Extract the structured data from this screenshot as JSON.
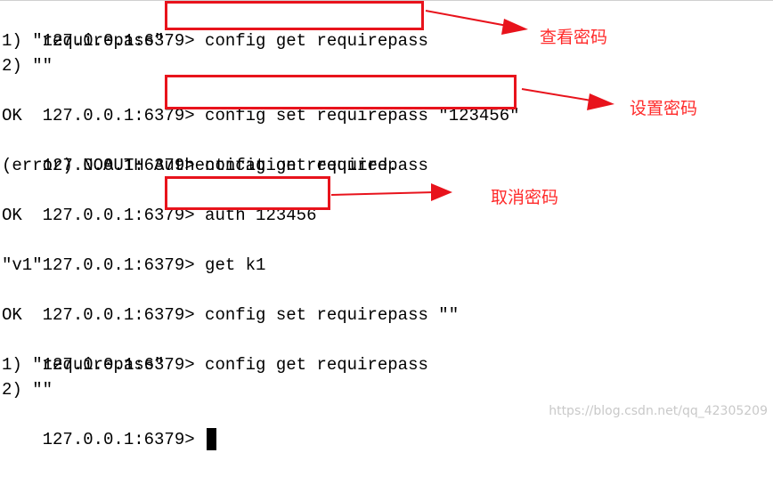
{
  "terminal": {
    "prompt": "127.0.0.1:6379> ",
    "lines": [
      {
        "prompt": "127.0.0.1:6379> ",
        "text": "config get requirepass"
      },
      {
        "text": "1) \"requirepass\""
      },
      {
        "text": "2) \"\""
      },
      {
        "prompt": "127.0.0.1:6379> ",
        "text": "config set requirepass \"123456\""
      },
      {
        "text": "OK"
      },
      {
        "prompt": "127.0.0.1:6379> ",
        "text": "config get requirepass"
      },
      {
        "text": "(error) NOAUTH Authentication required."
      },
      {
        "prompt": "127.0.0.1:6379> ",
        "text": "auth 123456"
      },
      {
        "text": "OK"
      },
      {
        "prompt": "127.0.0.1:6379> ",
        "text": "get k1"
      },
      {
        "text": "\"v1\""
      },
      {
        "prompt": "127.0.0.1:6379> ",
        "text": "config set requirepass \"\""
      },
      {
        "text": "OK"
      },
      {
        "prompt": "127.0.0.1:6379> ",
        "text": "config get requirepass"
      },
      {
        "text": "1) \"requirepass\""
      },
      {
        "text": "2) \"\""
      },
      {
        "prompt": "127.0.0.1:6379> ",
        "text": ""
      }
    ]
  },
  "annotations": {
    "view_password": "查看密码",
    "set_password": "设置密码",
    "cancel_password": "取消密码"
  },
  "colors": {
    "annotation": "#ff2a2a",
    "highlight_box": "#e8131c",
    "text": "#000000",
    "background": "#ffffff"
  },
  "watermark": "https://blog.csdn.net/qq_42305209"
}
